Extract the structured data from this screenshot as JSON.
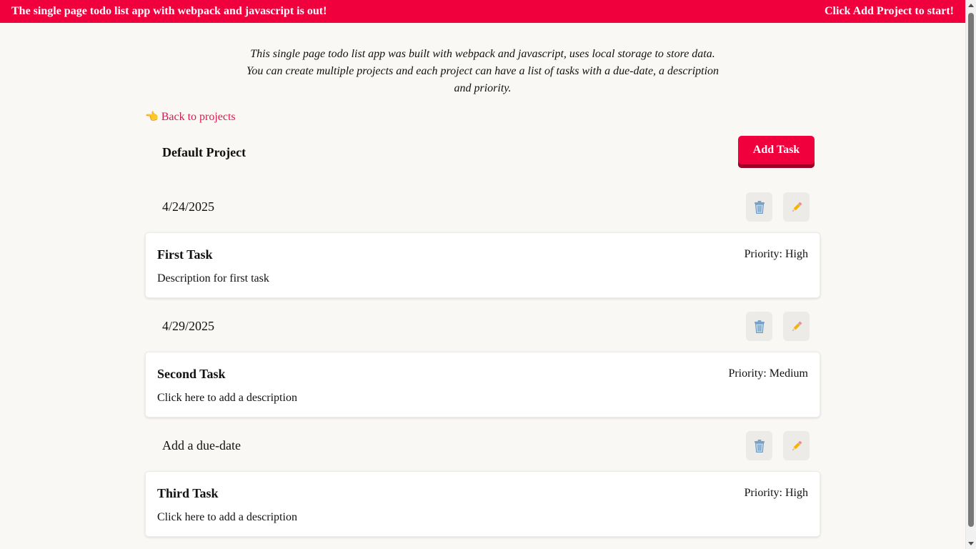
{
  "banner": {
    "left_text": "The single page todo list app with webpack and javascript is out!",
    "right_text": "Click Add Project to start!"
  },
  "intro": {
    "line1": "This single page todo list app was built with webpack and javascript, uses local storage to store data.",
    "line2": "You can create multiple projects and each project can have a list of tasks with a due-date, a description",
    "line3": "and priority."
  },
  "nav": {
    "back_label": "Back to projects",
    "back_icon": "pointing-hand-icon"
  },
  "project": {
    "title": "Default Project",
    "add_task_label": "Add Task"
  },
  "tasks": [
    {
      "due": "4/24/2025",
      "title": "First Task",
      "priority": "Priority: High",
      "description": "Description for first task"
    },
    {
      "due": "4/29/2025",
      "title": "Second Task",
      "priority": "Priority: Medium",
      "description": "Click here to add a description"
    },
    {
      "due": "Add a due-date",
      "title": "Third Task",
      "priority": "Priority: High",
      "description": "Click here to add a description"
    }
  ],
  "icons": {
    "delete": "trash-icon",
    "edit": "pencil-icon"
  },
  "colors": {
    "accent": "#f0003c",
    "link": "#d81b4f",
    "background": "#faf8f4"
  }
}
